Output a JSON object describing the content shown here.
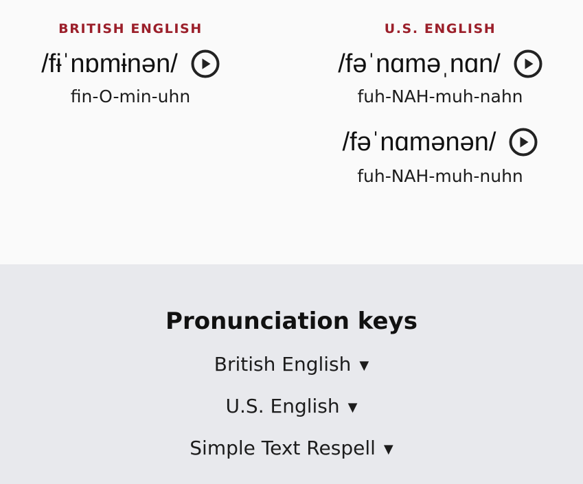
{
  "colors": {
    "variety_label": "#9b1f2a",
    "top_background": "#fafafa",
    "bottom_background": "#e8e9ed",
    "text": "#1c1c1c"
  },
  "british": {
    "label": "BRITISH ENGLISH",
    "entries": [
      {
        "ipa": "/fɨˈnɒmɨnən/",
        "respell": "fin-O-min-uhn",
        "icon": "play-circle-icon"
      }
    ]
  },
  "us": {
    "label": "U.S. ENGLISH",
    "entries": [
      {
        "ipa": "/fəˈnɑməˌnɑn/",
        "respell": "fuh-NAH-muh-nahn",
        "icon": "play-circle-icon"
      },
      {
        "ipa": "/fəˈnɑmənən/",
        "respell": "fuh-NAH-muh-nuhn",
        "icon": "play-circle-icon"
      }
    ]
  },
  "keys": {
    "title": "Pronunciation keys",
    "items": [
      {
        "label": "British English",
        "icon": "caret-down-icon",
        "caret": "▼"
      },
      {
        "label": "U.S. English",
        "icon": "caret-down-icon",
        "caret": "▼"
      },
      {
        "label": "Simple Text Respell",
        "icon": "caret-down-icon",
        "caret": "▼"
      }
    ]
  }
}
